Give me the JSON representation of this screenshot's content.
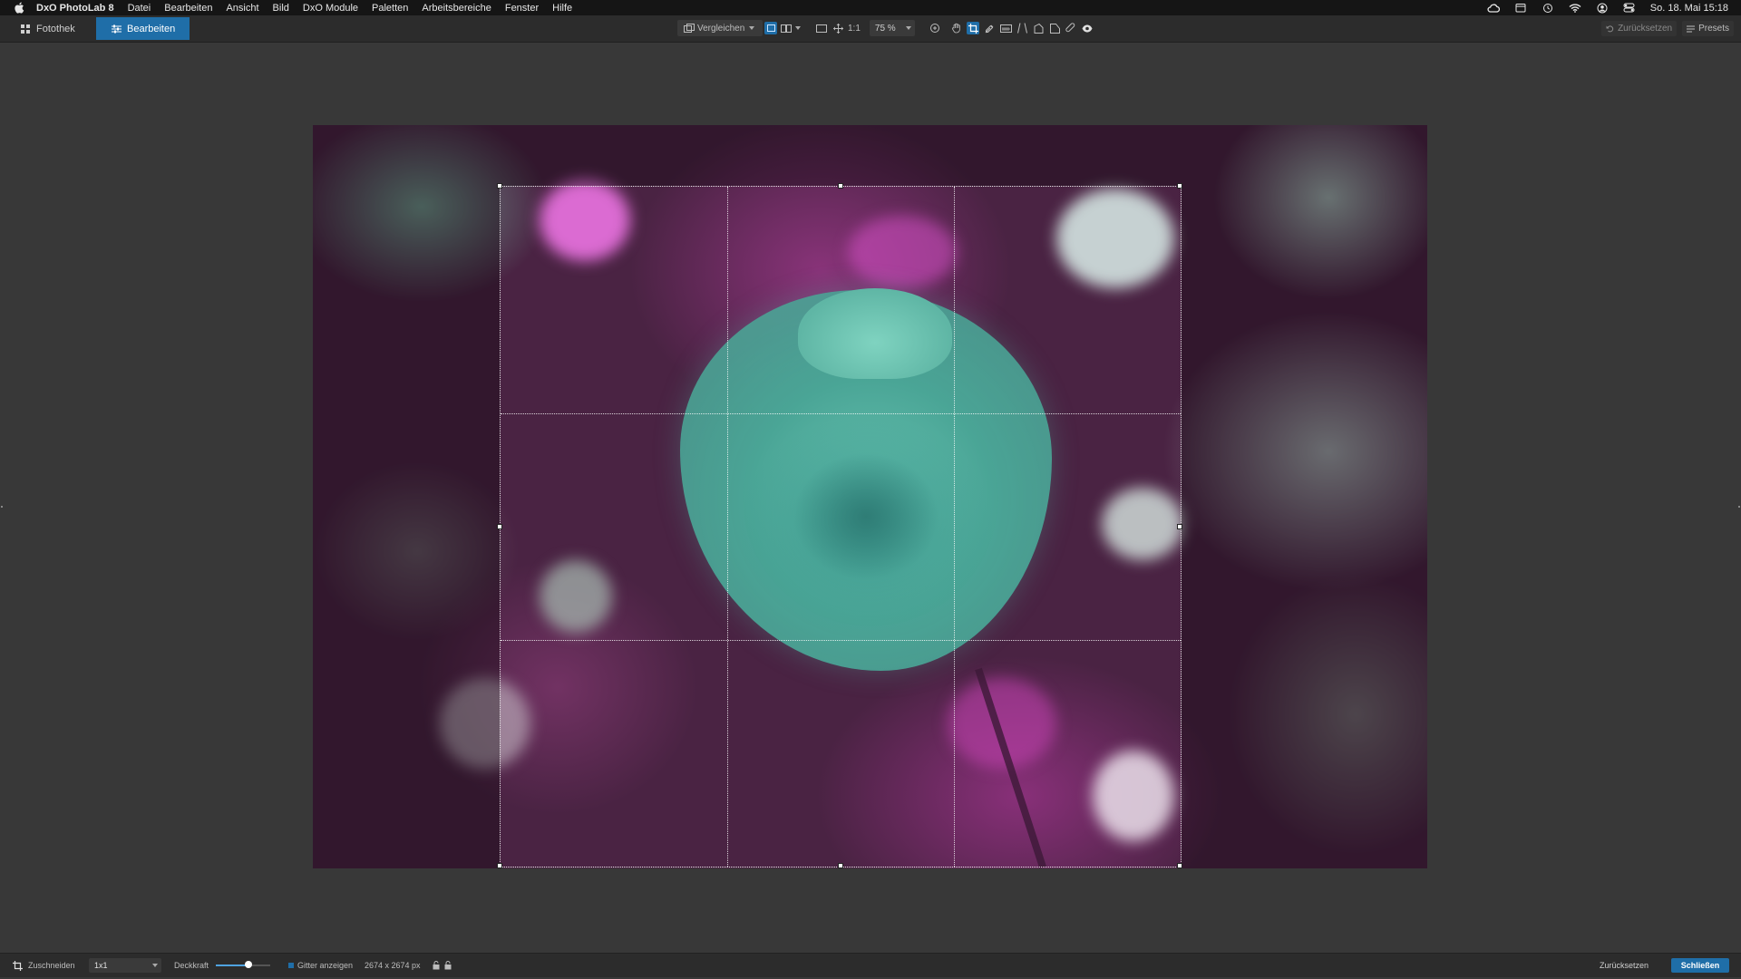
{
  "menubar": {
    "app_name": "DxO PhotoLab 8",
    "items": [
      "Datei",
      "Bearbeiten",
      "Ansicht",
      "Bild",
      "DxO Module",
      "Paletten",
      "Arbeitsbereiche",
      "Fenster",
      "Hilfe"
    ],
    "clock": "So. 18. Mai  15:18",
    "status_icons": [
      "creative-cloud-icon",
      "calendar-icon",
      "time-machine-icon",
      "wifi-icon",
      "user-account-icon",
      "control-center-icon"
    ]
  },
  "toolbar": {
    "tabs": [
      {
        "label": "Fotothek",
        "icon": "grid-icon"
      },
      {
        "label": "Bearbeiten",
        "icon": "sliders-icon",
        "active": true
      }
    ],
    "compare_label": "Vergleichen",
    "one_to_one": "1:1",
    "zoom": "75 %",
    "reset_label": "Zurücksetzen",
    "presets_label": "Presets",
    "tools": [
      "zoom-tool-icon",
      "hand-tool-icon",
      "crop-tool-icon",
      "eyedropper-icon",
      "horizon-icon",
      "perspective-icon",
      "local-adjust-icon",
      "mask-icon",
      "repair-icon",
      "preview-eye-icon"
    ],
    "active_tool": "crop-tool-icon"
  },
  "bottombar": {
    "crop_label": "Zuschneiden",
    "ratio": "1x1",
    "opacity_label": "Deckkraft",
    "opacity_value": 0.6,
    "grid_label": "Gitter anzeigen",
    "size": "2674 x 2674 px",
    "reset_label": "Zurücksetzen",
    "close_label": "Schließen"
  },
  "colors": {
    "accent": "#1f6ea8",
    "background": "#383838",
    "toolbar": "#2c2c2c",
    "menubar": "#151515"
  }
}
